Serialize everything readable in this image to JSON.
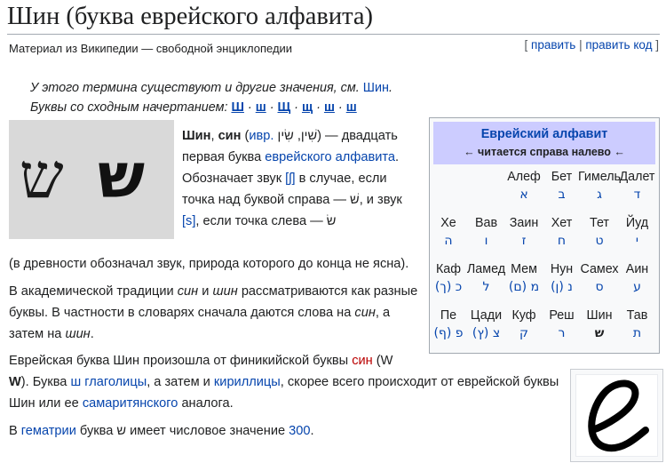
{
  "title": "Шин (буква еврейского алфавита)",
  "subtitle": "Материал из Википедии — свободной энциклопедии",
  "edit_links": {
    "edit": "править",
    "edit_code": "править код"
  },
  "hatnote": {
    "line1": "У этого термина существуют и другие значения, см.",
    "line1_link": "Шин",
    "line2": "Буквы со сходным начертанием:",
    "similar": [
      "Ш",
      "ш",
      "Щ",
      "щ",
      "ш",
      "ш"
    ]
  },
  "image_letters": [
    "ש",
    "ש"
  ],
  "intro": {
    "name1": "Шин",
    "name2": "син",
    "lang": "ивр.",
    "heb": "שִׁין, שִׂין",
    "t1": "— двадцать первая буква",
    "alphabet_link": "еврейского алфавита",
    "t2": "Обозначает звук",
    "sound1": "[ʃ]",
    "t3": "в случае, если точка над буквой справа —",
    "shin_dot": "שׁ",
    "t4": ", и звук",
    "sound2": "[s]",
    "t5": ", если точка слева —",
    "sin_dot": "שׂ",
    "t6": "(в древности обозначал звук, природа которого до конца не ясна)."
  },
  "para2": {
    "t1": "В академической традиции",
    "sin": "син",
    "t2": "и",
    "shin": "шин",
    "t3": "рассматриваются как разные буквы. В частности в словарях сначала даются слова на",
    "t4": ", а затем на",
    "t5": "."
  },
  "para3": {
    "t1": "Еврейская буква Шин произошла от финикийской буквы",
    "sin_link": "син",
    "t2": "(W",
    "w": "W",
    "t3": "). Буква",
    "glag_link": "ш глаголицы",
    "t4": ", а затем и",
    "cyr_link": "кириллицы",
    "t5": ", скорее всего происходит от еврейской буквы Шин или ее",
    "sam_link": "самаритянского",
    "t6": "аналога."
  },
  "para4": {
    "t1": "В",
    "gem_link": "гематрии",
    "t2": "буква ש имеет числовое значение",
    "value_link": "300",
    "t3": "."
  },
  "infobox": {
    "title": "Еврейский алфавит",
    "direction": "← читается справа налево ←",
    "rows": [
      [
        {
          "name": "Далет",
          "char": "ד"
        },
        {
          "name": "Гимель",
          "char": "ג"
        },
        {
          "name": "Бет",
          "char": "ב"
        },
        {
          "name": "Алеф",
          "char": "א"
        }
      ],
      [
        {
          "name": "Йуд",
          "char": "י"
        },
        {
          "name": "Тет",
          "char": "ט"
        },
        {
          "name": "Хет",
          "char": "ח"
        },
        {
          "name": "Заин",
          "char": "ז"
        },
        {
          "name": "Вав",
          "char": "ו"
        },
        {
          "name": "Хе",
          "char": "ה"
        }
      ],
      [
        {
          "name": "Аин",
          "char": "ע"
        },
        {
          "name": "Самех",
          "char": "ס"
        },
        {
          "name": "Нун",
          "char": "(ן) נ"
        },
        {
          "name": "Мем",
          "char": "(ם) מ"
        },
        {
          "name": "Ламед",
          "char": "ל"
        },
        {
          "name": "Каф",
          "char": "(ך) כ"
        }
      ],
      [
        {
          "name": "Тав",
          "char": "ת"
        },
        {
          "name": "Шин",
          "char": "ש"
        },
        {
          "name": "Реш",
          "char": "ר"
        },
        {
          "name": "Куф",
          "char": "ק"
        },
        {
          "name": "Цади",
          "char": "(ץ) צ"
        },
        {
          "name": "Пе",
          "char": "(ף) פ"
        }
      ]
    ]
  }
}
